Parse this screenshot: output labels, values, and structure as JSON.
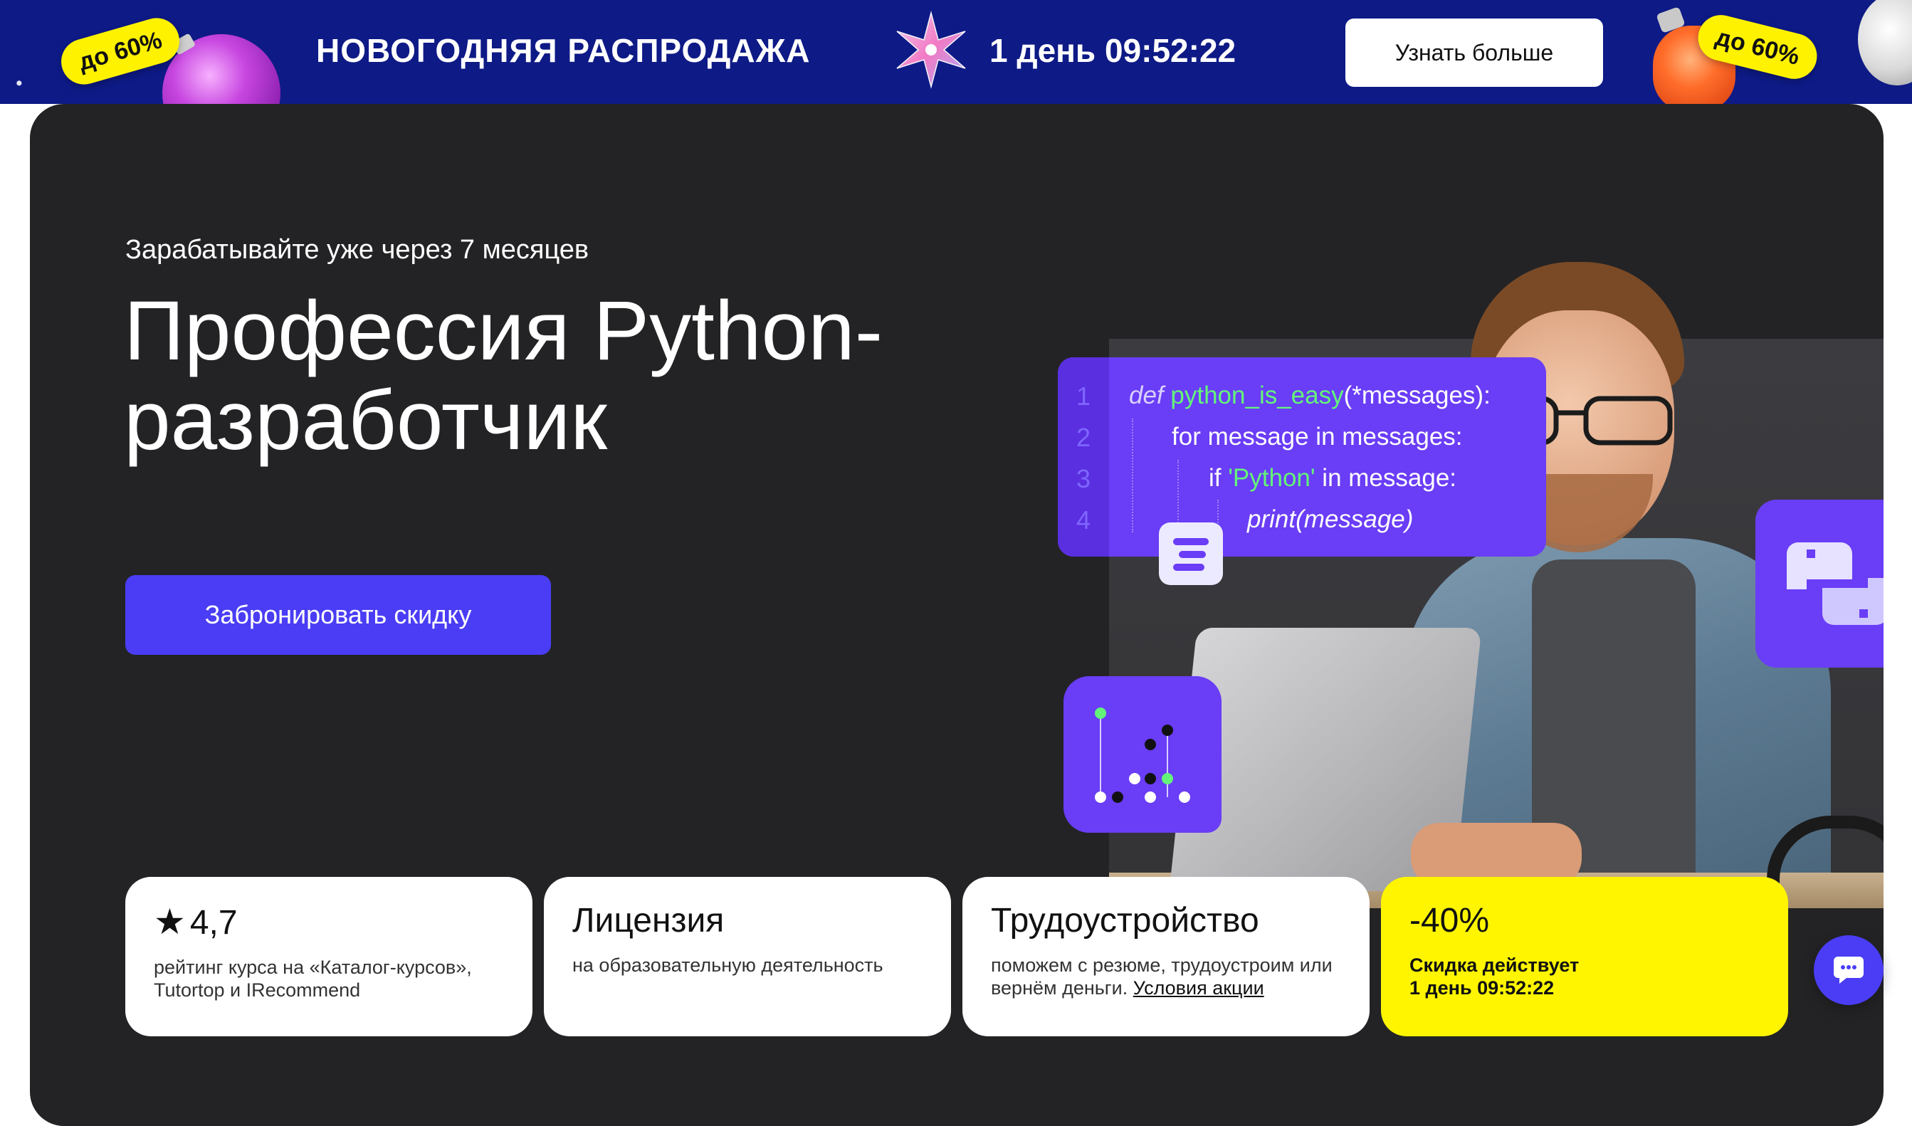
{
  "banner": {
    "sale_tag_left": "до 60%",
    "sale_tag_right": "до 60%",
    "title": "НОВОГОДНЯЯ РАСПРОДАЖА",
    "timer": "1 день 09:52:22",
    "button_label": "Узнать больше",
    "background_color": "#0e1a86"
  },
  "hero": {
    "subtitle": "Зарабатывайте уже через 7 месяцев",
    "title_line1": "Профессия Python-",
    "title_line2": "разработчик",
    "cta_label": "Забронировать скидку",
    "accent_color": "#4a3df5"
  },
  "code": {
    "line_numbers": [
      "1",
      "2",
      "3",
      "4"
    ],
    "line1_keyword": "def",
    "line1_name": "python_is_easy",
    "line1_rest": "(*messages):",
    "line2": "for message in messages:",
    "line3_start": "if ",
    "line3_string": "'Python'",
    "line3_end": " in message:",
    "line4": "print(message)"
  },
  "cards": [
    {
      "rating": "4,7",
      "text": "рейтинг курса на «Каталог-курсов», Tutortop и IRecommend"
    },
    {
      "title": "Лицензия",
      "text": "на образовательную деятельность"
    },
    {
      "title": "Трудоустройство",
      "text": "поможем с резюме, трудоустроим или вернём деньги.",
      "link": "Условия акции"
    },
    {
      "title": "-40%",
      "text_line1": "Скидка  действует",
      "text_line2": "1 день 09:52:22"
    }
  ]
}
